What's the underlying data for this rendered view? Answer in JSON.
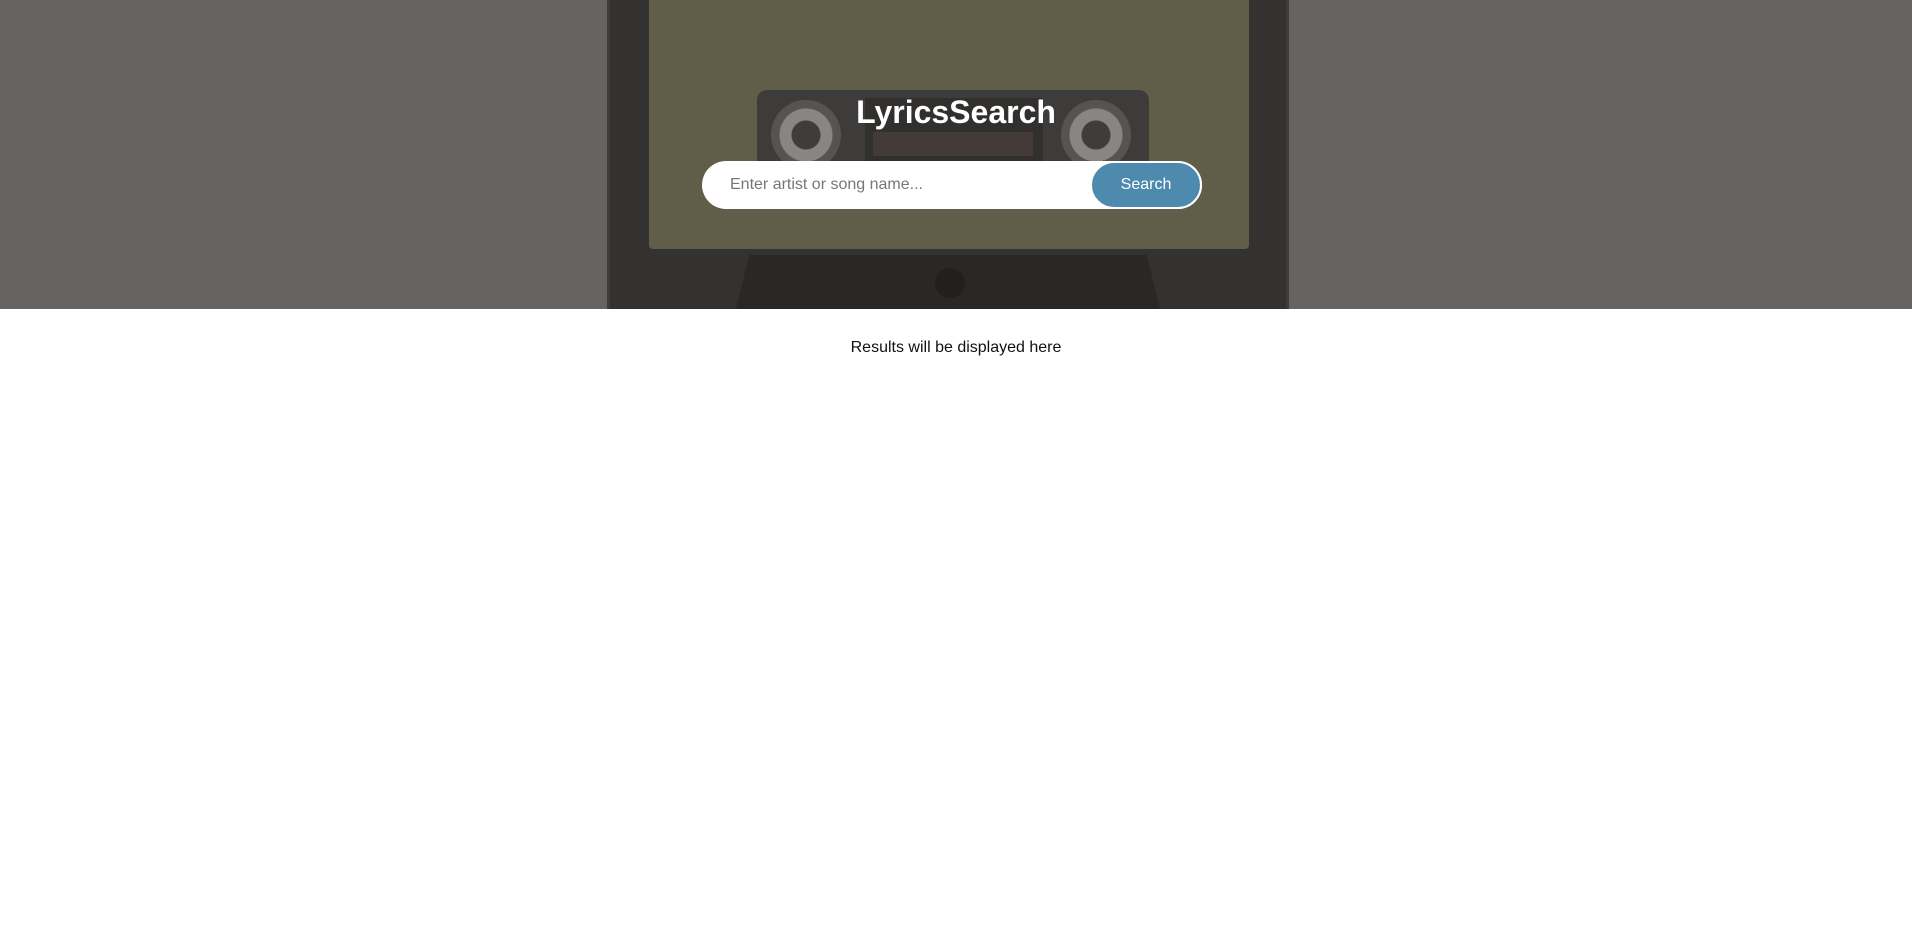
{
  "app": {
    "title": "LyricsSearch"
  },
  "search": {
    "placeholder": "Enter artist or song name...",
    "value": "",
    "button_label": "Search"
  },
  "results": {
    "placeholder_text": "Results will be displayed here"
  },
  "colors": {
    "accent": "#4e89ae",
    "hero_overlay": "#6f6e6c",
    "background": "#ffffff"
  }
}
